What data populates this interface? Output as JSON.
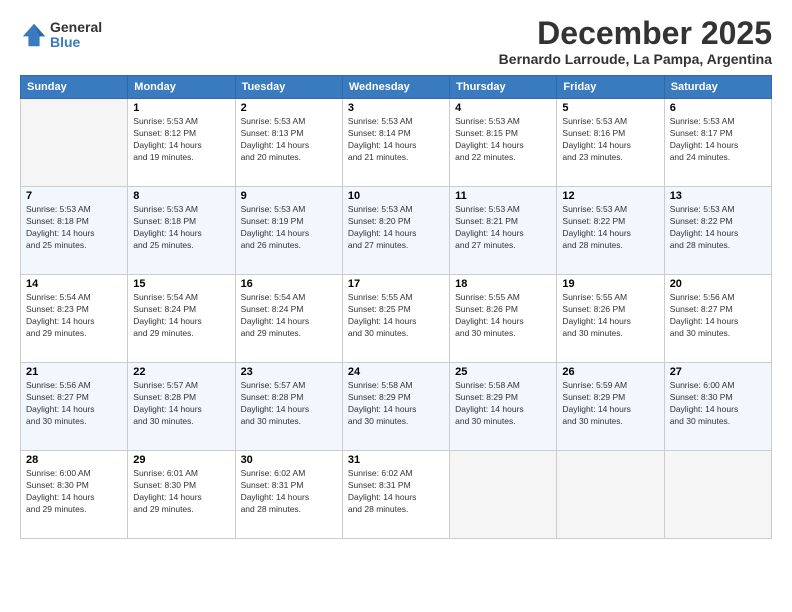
{
  "header": {
    "logo": {
      "general": "General",
      "blue": "Blue"
    },
    "title": "December 2025",
    "subtitle": "Bernardo Larroude, La Pampa, Argentina"
  },
  "weekdays": [
    "Sunday",
    "Monday",
    "Tuesday",
    "Wednesday",
    "Thursday",
    "Friday",
    "Saturday"
  ],
  "weeks": [
    [
      {
        "day": "",
        "info": ""
      },
      {
        "day": "1",
        "info": "Sunrise: 5:53 AM\nSunset: 8:12 PM\nDaylight: 14 hours\nand 19 minutes."
      },
      {
        "day": "2",
        "info": "Sunrise: 5:53 AM\nSunset: 8:13 PM\nDaylight: 14 hours\nand 20 minutes."
      },
      {
        "day": "3",
        "info": "Sunrise: 5:53 AM\nSunset: 8:14 PM\nDaylight: 14 hours\nand 21 minutes."
      },
      {
        "day": "4",
        "info": "Sunrise: 5:53 AM\nSunset: 8:15 PM\nDaylight: 14 hours\nand 22 minutes."
      },
      {
        "day": "5",
        "info": "Sunrise: 5:53 AM\nSunset: 8:16 PM\nDaylight: 14 hours\nand 23 minutes."
      },
      {
        "day": "6",
        "info": "Sunrise: 5:53 AM\nSunset: 8:17 PM\nDaylight: 14 hours\nand 24 minutes."
      }
    ],
    [
      {
        "day": "7",
        "info": "Sunrise: 5:53 AM\nSunset: 8:18 PM\nDaylight: 14 hours\nand 25 minutes."
      },
      {
        "day": "8",
        "info": "Sunrise: 5:53 AM\nSunset: 8:18 PM\nDaylight: 14 hours\nand 25 minutes."
      },
      {
        "day": "9",
        "info": "Sunrise: 5:53 AM\nSunset: 8:19 PM\nDaylight: 14 hours\nand 26 minutes."
      },
      {
        "day": "10",
        "info": "Sunrise: 5:53 AM\nSunset: 8:20 PM\nDaylight: 14 hours\nand 27 minutes."
      },
      {
        "day": "11",
        "info": "Sunrise: 5:53 AM\nSunset: 8:21 PM\nDaylight: 14 hours\nand 27 minutes."
      },
      {
        "day": "12",
        "info": "Sunrise: 5:53 AM\nSunset: 8:22 PM\nDaylight: 14 hours\nand 28 minutes."
      },
      {
        "day": "13",
        "info": "Sunrise: 5:53 AM\nSunset: 8:22 PM\nDaylight: 14 hours\nand 28 minutes."
      }
    ],
    [
      {
        "day": "14",
        "info": "Sunrise: 5:54 AM\nSunset: 8:23 PM\nDaylight: 14 hours\nand 29 minutes."
      },
      {
        "day": "15",
        "info": "Sunrise: 5:54 AM\nSunset: 8:24 PM\nDaylight: 14 hours\nand 29 minutes."
      },
      {
        "day": "16",
        "info": "Sunrise: 5:54 AM\nSunset: 8:24 PM\nDaylight: 14 hours\nand 29 minutes."
      },
      {
        "day": "17",
        "info": "Sunrise: 5:55 AM\nSunset: 8:25 PM\nDaylight: 14 hours\nand 30 minutes."
      },
      {
        "day": "18",
        "info": "Sunrise: 5:55 AM\nSunset: 8:26 PM\nDaylight: 14 hours\nand 30 minutes."
      },
      {
        "day": "19",
        "info": "Sunrise: 5:55 AM\nSunset: 8:26 PM\nDaylight: 14 hours\nand 30 minutes."
      },
      {
        "day": "20",
        "info": "Sunrise: 5:56 AM\nSunset: 8:27 PM\nDaylight: 14 hours\nand 30 minutes."
      }
    ],
    [
      {
        "day": "21",
        "info": "Sunrise: 5:56 AM\nSunset: 8:27 PM\nDaylight: 14 hours\nand 30 minutes."
      },
      {
        "day": "22",
        "info": "Sunrise: 5:57 AM\nSunset: 8:28 PM\nDaylight: 14 hours\nand 30 minutes."
      },
      {
        "day": "23",
        "info": "Sunrise: 5:57 AM\nSunset: 8:28 PM\nDaylight: 14 hours\nand 30 minutes."
      },
      {
        "day": "24",
        "info": "Sunrise: 5:58 AM\nSunset: 8:29 PM\nDaylight: 14 hours\nand 30 minutes."
      },
      {
        "day": "25",
        "info": "Sunrise: 5:58 AM\nSunset: 8:29 PM\nDaylight: 14 hours\nand 30 minutes."
      },
      {
        "day": "26",
        "info": "Sunrise: 5:59 AM\nSunset: 8:29 PM\nDaylight: 14 hours\nand 30 minutes."
      },
      {
        "day": "27",
        "info": "Sunrise: 6:00 AM\nSunset: 8:30 PM\nDaylight: 14 hours\nand 30 minutes."
      }
    ],
    [
      {
        "day": "28",
        "info": "Sunrise: 6:00 AM\nSunset: 8:30 PM\nDaylight: 14 hours\nand 29 minutes."
      },
      {
        "day": "29",
        "info": "Sunrise: 6:01 AM\nSunset: 8:30 PM\nDaylight: 14 hours\nand 29 minutes."
      },
      {
        "day": "30",
        "info": "Sunrise: 6:02 AM\nSunset: 8:31 PM\nDaylight: 14 hours\nand 28 minutes."
      },
      {
        "day": "31",
        "info": "Sunrise: 6:02 AM\nSunset: 8:31 PM\nDaylight: 14 hours\nand 28 minutes."
      },
      {
        "day": "",
        "info": ""
      },
      {
        "day": "",
        "info": ""
      },
      {
        "day": "",
        "info": ""
      }
    ]
  ]
}
